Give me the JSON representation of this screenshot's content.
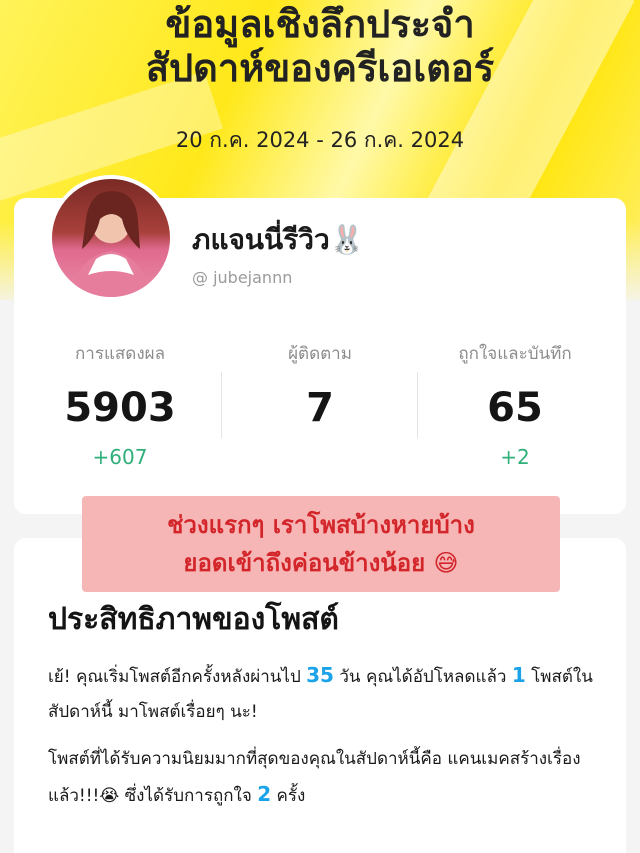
{
  "header": {
    "title_line1": "ข้อมูลเชิงลึกประจำ",
    "title_line2": "สัปดาห์ของครีเอเตอร์",
    "date_range": "20 ก.ค. 2024 - 26 ก.ค. 2024"
  },
  "profile": {
    "name": "ภแจนนี่รีวิว🐰",
    "handle": "@ jubejannn"
  },
  "stats": [
    {
      "label": "การแสดงผล",
      "value": "5903",
      "delta": "+607"
    },
    {
      "label": "ผู้ติดตาม",
      "value": "7",
      "delta": ""
    },
    {
      "label": "ถูกใจและบันทึก",
      "value": "65",
      "delta": "+2"
    }
  ],
  "note": {
    "line1": "ช่วงแรกๆ เราโพสบ้างหายบ้าง",
    "line2": "ยอดเข้าถึงค่อนข้างน้อย 😅"
  },
  "performance": {
    "title": "ประสิทธิภาพของโพสต์",
    "p1_a": "เย้! คุณเริ่มโพสต์อีกครั้งหลังผ่านไป ",
    "p1_days": "35",
    "p1_b": " วัน คุณได้อัปโหลดแล้ว ",
    "p1_posts": "1",
    "p1_c": " โพสต์ในสัปดาห์นี้ มาโพสต์เรื่อยๆ นะ!",
    "p2_a": "โพสต์ที่ได้รับความนิยมมากที่สุดของคุณในสัปดาห์นี้คือ แคนเมคสร้างเรื่องแล้ว!!!😭 ซึ่งได้รับการถูกใจ ",
    "p2_likes": "2",
    "p2_b": " ครั้ง"
  },
  "colors": {
    "accent_yellow": "#ffe81a",
    "positive_green": "#2fb07a",
    "highlight_blue": "#1aa3e8",
    "note_bg": "#f7b6b6",
    "note_text": "#d3262b"
  }
}
